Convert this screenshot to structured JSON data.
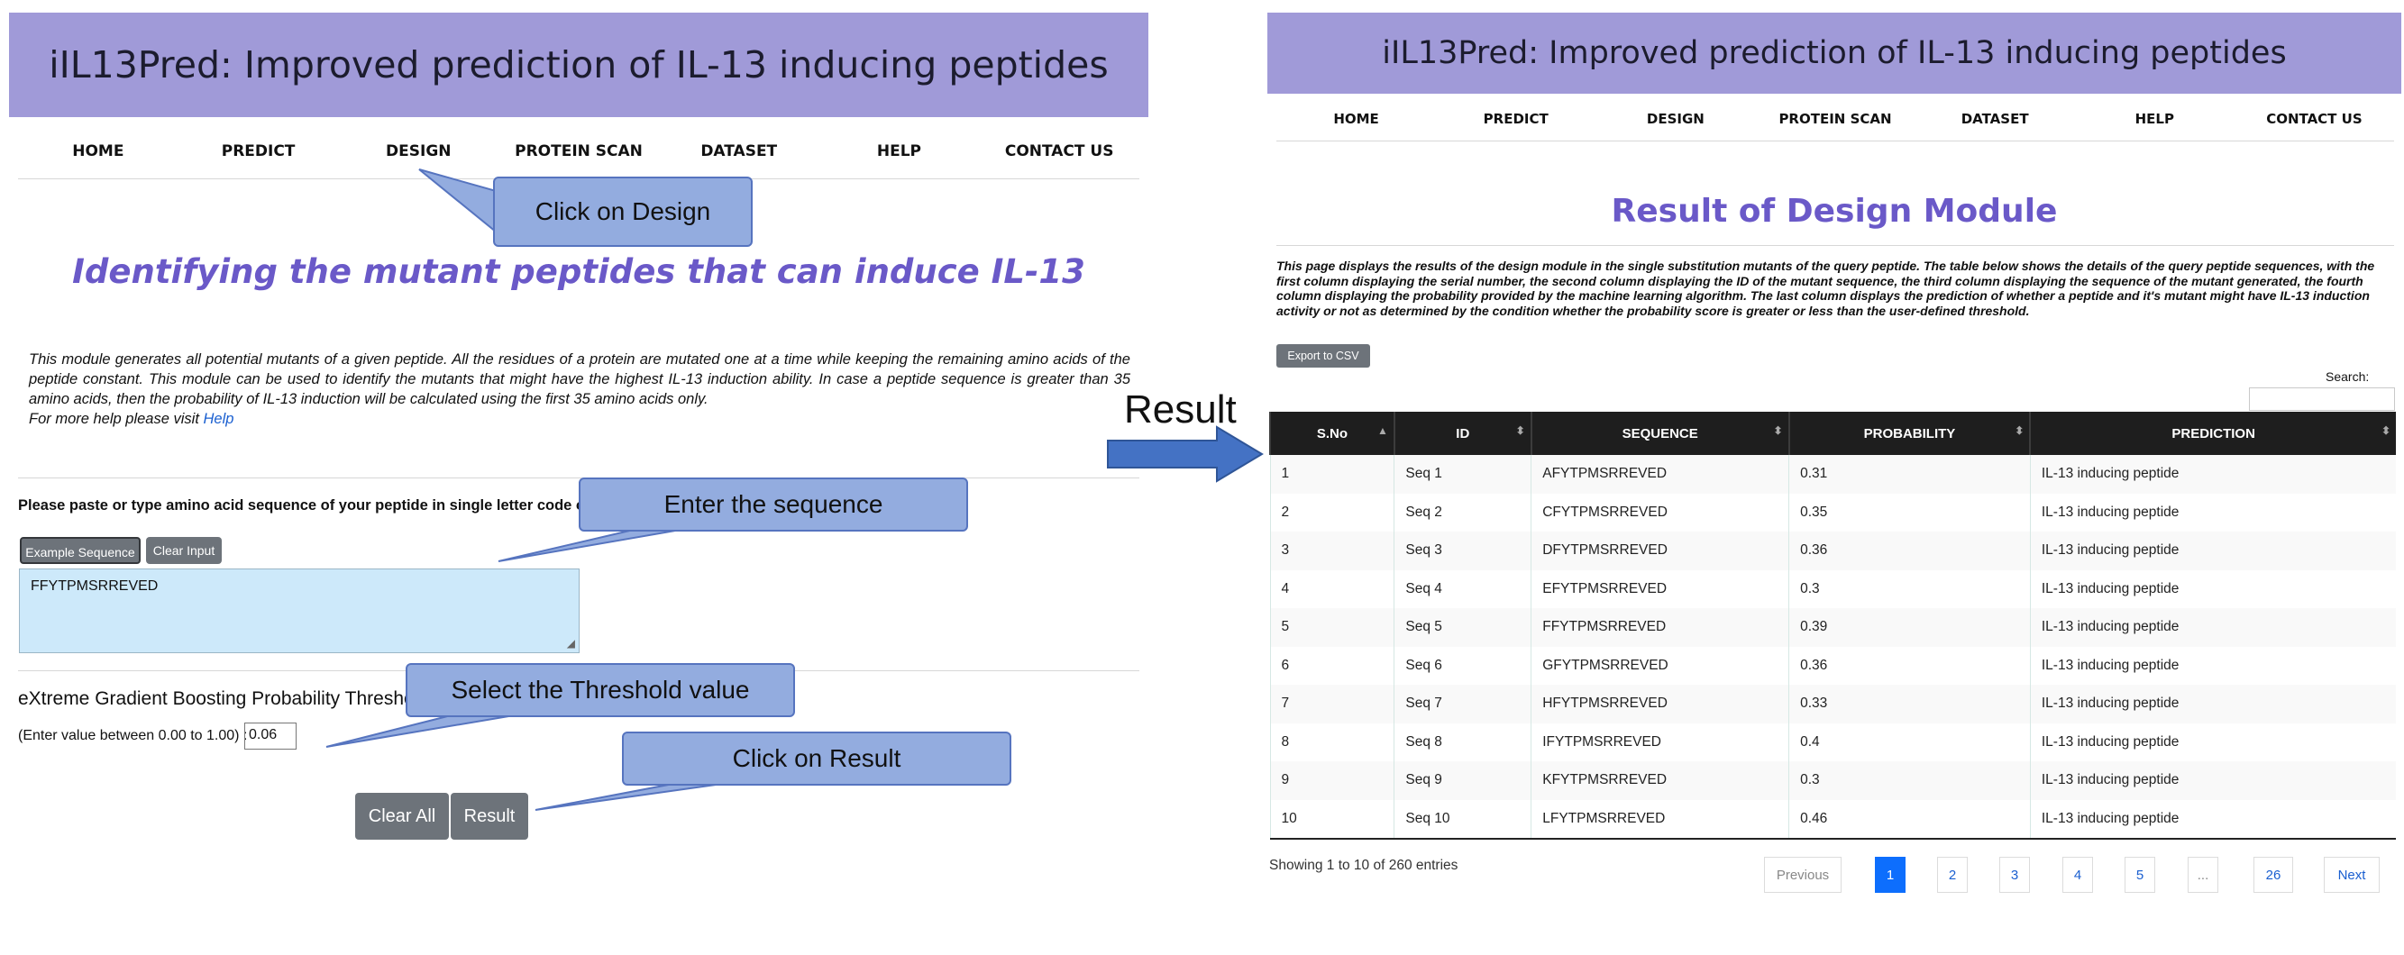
{
  "left": {
    "banner_title": "iIL13Pred: Improved prediction of IL-13 inducing peptides",
    "nav": [
      "HOME",
      "PREDICT",
      "DESIGN",
      "PROTEIN SCAN",
      "DATASET",
      "HELP",
      "CONTACT US"
    ],
    "heading": "Identifying the mutant peptides that can induce IL-13",
    "description": "This module generates all potential mutants of a given peptide. All the residues of a protein are mutated one at a time while keeping the remaining amino acids of the peptide constant. This module can be used to identify the mutants that might have the highest IL-13 induction ability. In case a peptide sequence is greater than 35 amino acids, then the probability of IL-13 induction will be calculated using the first 35 amino acids only.",
    "help_prefix": "For more help please visit ",
    "help_link": "Help",
    "sequence_label": "Please paste or type amino acid sequence of your peptide in single letter code only:",
    "example_button": "Example Sequence",
    "clear_input_button": "Clear Input",
    "sequence_value": "FFYTPMSRREVED",
    "threshold_label": "eXtreme Gradient Boosting Probability Threshold:",
    "threshold_hint": "(Enter value between 0.00 to 1.00) :",
    "threshold_value": "0.06",
    "clear_all_button": "Clear All",
    "result_button": "Result"
  },
  "callouts": {
    "design": "Click on Design",
    "sequence": "Enter the sequence",
    "threshold": "Select the Threshold value",
    "result": "Click on Result"
  },
  "result_label": "Result",
  "right": {
    "banner_title": "iIL13Pred: Improved prediction of IL-13 inducing peptides",
    "nav": [
      "HOME",
      "PREDICT",
      "DESIGN",
      "PROTEIN SCAN",
      "DATASET",
      "HELP",
      "CONTACT US"
    ],
    "title": "Result of Design Module",
    "description": "This page displays the results of the design module in the single substitution mutants of the query peptide. The table below shows the details of the query peptide sequences, with the first column displaying the serial number, the second column displaying the ID of the mutant sequence, the third column displaying the sequence of the mutant generated, the fourth column displaying the probability provided by the machine learning algorithm. The last column displays the prediction of whether a peptide and it's mutant might have IL-13 induction activity or not as determined by the condition whether the probability score is greater or less than the user-defined threshold.",
    "export_button": "Export to CSV",
    "search_label": "Search:",
    "table": {
      "headers": [
        "S.No",
        "ID",
        "SEQUENCE",
        "PROBABILITY",
        "PREDICTION"
      ],
      "rows": [
        [
          "1",
          "Seq 1",
          "AFYTPMSRREVED",
          "0.31",
          "IL-13 inducing peptide"
        ],
        [
          "2",
          "Seq 2",
          "CFYTPMSRREVED",
          "0.35",
          "IL-13 inducing peptide"
        ],
        [
          "3",
          "Seq 3",
          "DFYTPMSRREVED",
          "0.36",
          "IL-13 inducing peptide"
        ],
        [
          "4",
          "Seq 4",
          "EFYTPMSRREVED",
          "0.3",
          "IL-13 inducing peptide"
        ],
        [
          "5",
          "Seq 5",
          "FFYTPMSRREVED",
          "0.39",
          "IL-13 inducing peptide"
        ],
        [
          "6",
          "Seq 6",
          "GFYTPMSRREVED",
          "0.36",
          "IL-13 inducing peptide"
        ],
        [
          "7",
          "Seq 7",
          "HFYTPMSRREVED",
          "0.33",
          "IL-13 inducing peptide"
        ],
        [
          "8",
          "Seq 8",
          "IFYTPMSRREVED",
          "0.4",
          "IL-13 inducing peptide"
        ],
        [
          "9",
          "Seq 9",
          "KFYTPMSRREVED",
          "0.3",
          "IL-13 inducing peptide"
        ],
        [
          "10",
          "Seq 10",
          "LFYTPMSRREVED",
          "0.46",
          "IL-13 inducing peptide"
        ]
      ]
    },
    "entries_info": "Showing 1 to 10 of 260 entries",
    "pagination": {
      "previous": "Previous",
      "pages": [
        "1",
        "2",
        "3",
        "4",
        "5",
        "...",
        "26"
      ],
      "next": "Next"
    }
  },
  "colors": {
    "banner": "#a09ad8",
    "heading": "#6a59c8",
    "callout_fill": "#93acdf",
    "callout_border": "#5674bf",
    "arrow": "#4472c4",
    "active_page": "#0d6efd"
  }
}
